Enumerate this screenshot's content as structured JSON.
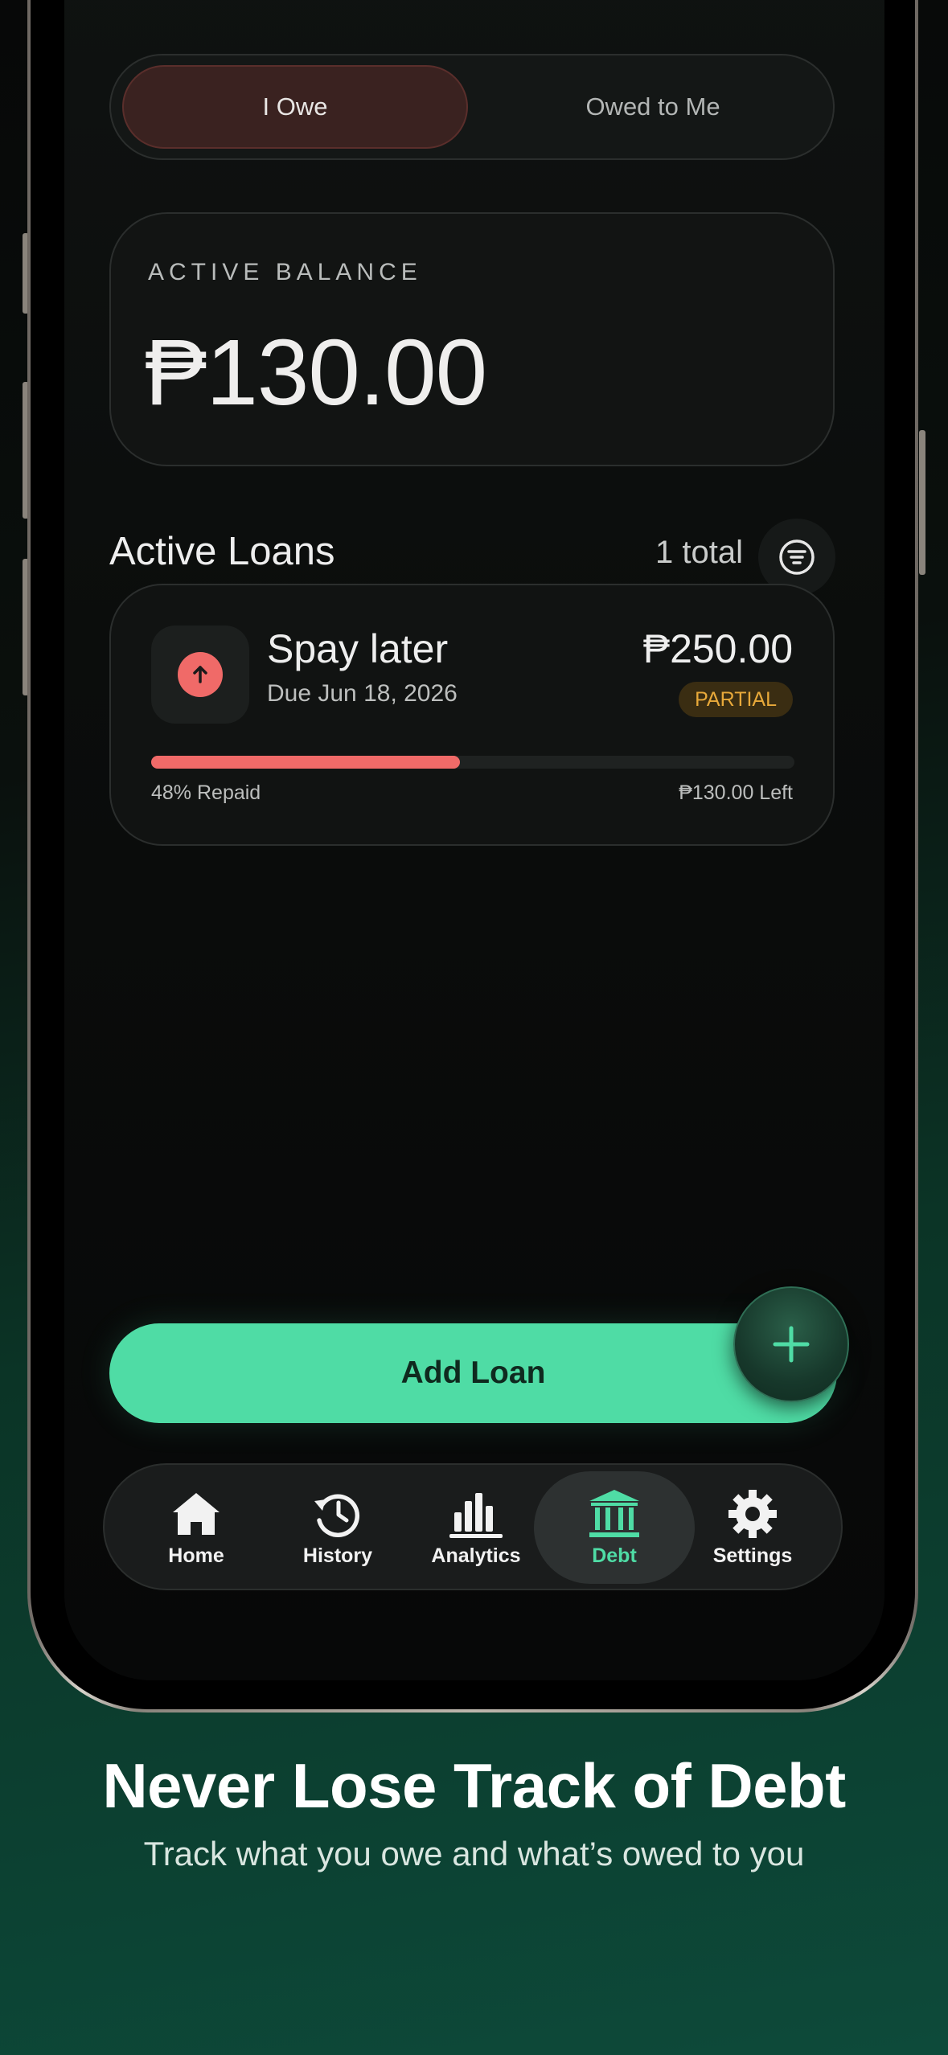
{
  "segment": {
    "active_label": "I Owe",
    "other_label": "Owed to Me"
  },
  "balance": {
    "label": "ACTIVE BALANCE",
    "amount": "₱130.00"
  },
  "loans_header": {
    "title": "Active Loans",
    "count": "1 total",
    "filter_icon": "filter-icon"
  },
  "loans": [
    {
      "name": "Spay later",
      "due": "Due Jun 18, 2026",
      "amount": "₱250.00",
      "status": "PARTIAL",
      "progress_label": "48% Repaid",
      "progress_fraction": 0.48,
      "left_label": "₱130.00 Left",
      "icon": "arrow-up-icon"
    }
  ],
  "add_loan": {
    "label": "Add Loan",
    "fab_icon": "plus-icon"
  },
  "tabs": [
    {
      "label": "Home",
      "icon": "home-icon"
    },
    {
      "label": "History",
      "icon": "history-icon"
    },
    {
      "label": "Analytics",
      "icon": "bar-chart-icon"
    },
    {
      "label": "Debt",
      "icon": "bank-icon",
      "active": true
    },
    {
      "label": "Settings",
      "icon": "gear-icon"
    }
  ],
  "promo": {
    "headline": "Never Lose Track of Debt",
    "subline": "Track what you owe and what’s owed to you"
  },
  "colors": {
    "accent": "#4fdca5",
    "danger": "#f06a68",
    "warning": "#e8a93a"
  }
}
